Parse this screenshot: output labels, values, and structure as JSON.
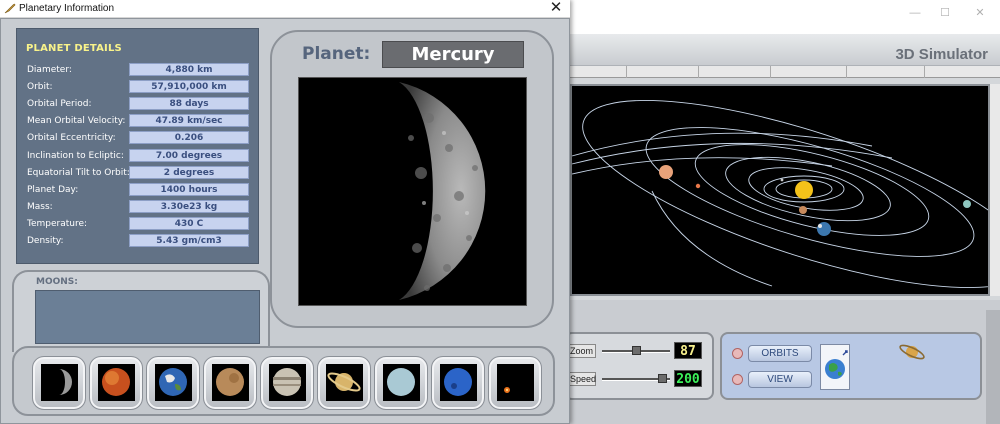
{
  "dialog": {
    "title": "Planetary Information",
    "close_glyph": "✕",
    "details_header": "PLANET DETAILS",
    "rows": [
      {
        "label": "Diameter:",
        "value": "4,880 km"
      },
      {
        "label": "Orbit:",
        "value": "57,910,000 km"
      },
      {
        "label": "Orbital Period:",
        "value": "88 days"
      },
      {
        "label": "Mean Orbital Velocity:",
        "value": "47.89 km/sec"
      },
      {
        "label": "Orbital  Eccentricity:",
        "value": "0.206"
      },
      {
        "label": "Inclination to Ecliptic:",
        "value": "7.00 degrees"
      },
      {
        "label": "Equatorial Tilt to Orbit:",
        "value": "2 degrees"
      },
      {
        "label": "Planet Day:",
        "value": "1400 hours"
      },
      {
        "label": "Mass:",
        "value": "3.30e23 kg"
      },
      {
        "label": "Temperature:",
        "value": "430 C"
      },
      {
        "label": "Density:",
        "value": "5.43 gm/cm3"
      }
    ],
    "planet_label": "Planet:",
    "planet_name": "Mercury",
    "moons_label": "MOONS:",
    "moons": [],
    "thumbnails": [
      "mercury-icon",
      "venus-icon",
      "earth-icon",
      "mars-icon",
      "jupiter-icon",
      "saturn-icon",
      "uranus-icon",
      "neptune-icon",
      "pluto-icon"
    ]
  },
  "simulator": {
    "title": "3D Simulator",
    "window_controls": [
      "—",
      "☐",
      "✕"
    ],
    "zoom_label": "Zoom",
    "zoom_value": "87",
    "speed_label": "Speed",
    "speed_value": "200",
    "orbits_button": "ORBITS",
    "view_button": "VIEW"
  },
  "colors": {
    "details_panel": "#627286",
    "value_box": "#c7d3ef",
    "header_yellow": "#f9f38a",
    "lcd_yellow": "#f8f18d",
    "lcd_green": "#3cf15a"
  }
}
